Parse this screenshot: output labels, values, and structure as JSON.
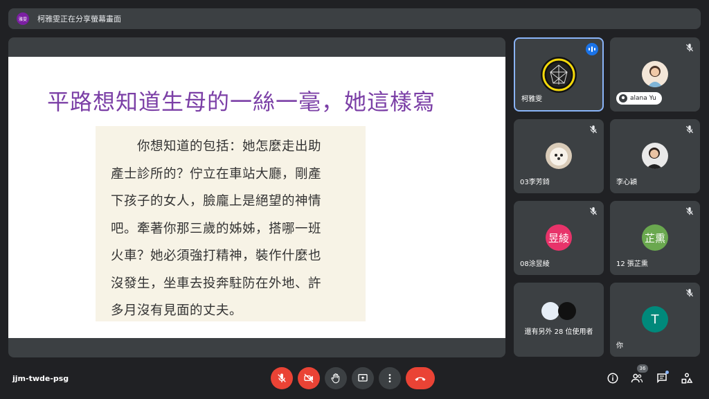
{
  "topbar": {
    "presenter_avatar": "雅雯",
    "sharing_text": "柯雅雯正在分享螢幕畫面"
  },
  "slide": {
    "title": "平路想知道生母的一絲一毫，她這樣寫",
    "quote_lines": [
      "　　你想知道的包括：她怎麼走出助",
      "產士診所的？佇立在車站大廳，剛產",
      "下孩子的女人，臉龐上是絕望的神情",
      "吧。牽著你那三歲的姊姊，搭哪一班",
      "火車？她必須強打精神，裝作什麼也",
      "沒發生，坐車去投奔駐防在外地、許",
      "多月沒有見面的丈夫。"
    ]
  },
  "participants": {
    "p1_name": "柯雅雯",
    "p2_name": "alana Yu",
    "p3_name": "03李芳錡",
    "p4_name": "李心穎",
    "p5_avatar": "昱綾",
    "p5_name": "08涂昱綾",
    "p6_avatar": "芷熏",
    "p6_name": "12 張芷熏",
    "others_label": "還有另外 28 位使用者",
    "self_avatar": "T",
    "self_name": "你"
  },
  "bottom": {
    "meeting_code": "jjm-twde-psg",
    "people_count": "36"
  },
  "colors": {
    "accent": "#8ab4f8",
    "danger": "#ea4335",
    "tile_bg": "#3c4043",
    "bg": "#202124",
    "title_purple": "#7b3fa6",
    "avatar_pink": "#e8336a",
    "avatar_green": "#6aa84f",
    "avatar_teal": "#00897b"
  },
  "icons": [
    "mic-off-icon",
    "camera-off-icon",
    "raise-hand-icon",
    "present-icon",
    "more-options-icon",
    "end-call-icon",
    "info-icon",
    "people-icon",
    "chat-icon",
    "activities-icon",
    "speaking-icon"
  ]
}
